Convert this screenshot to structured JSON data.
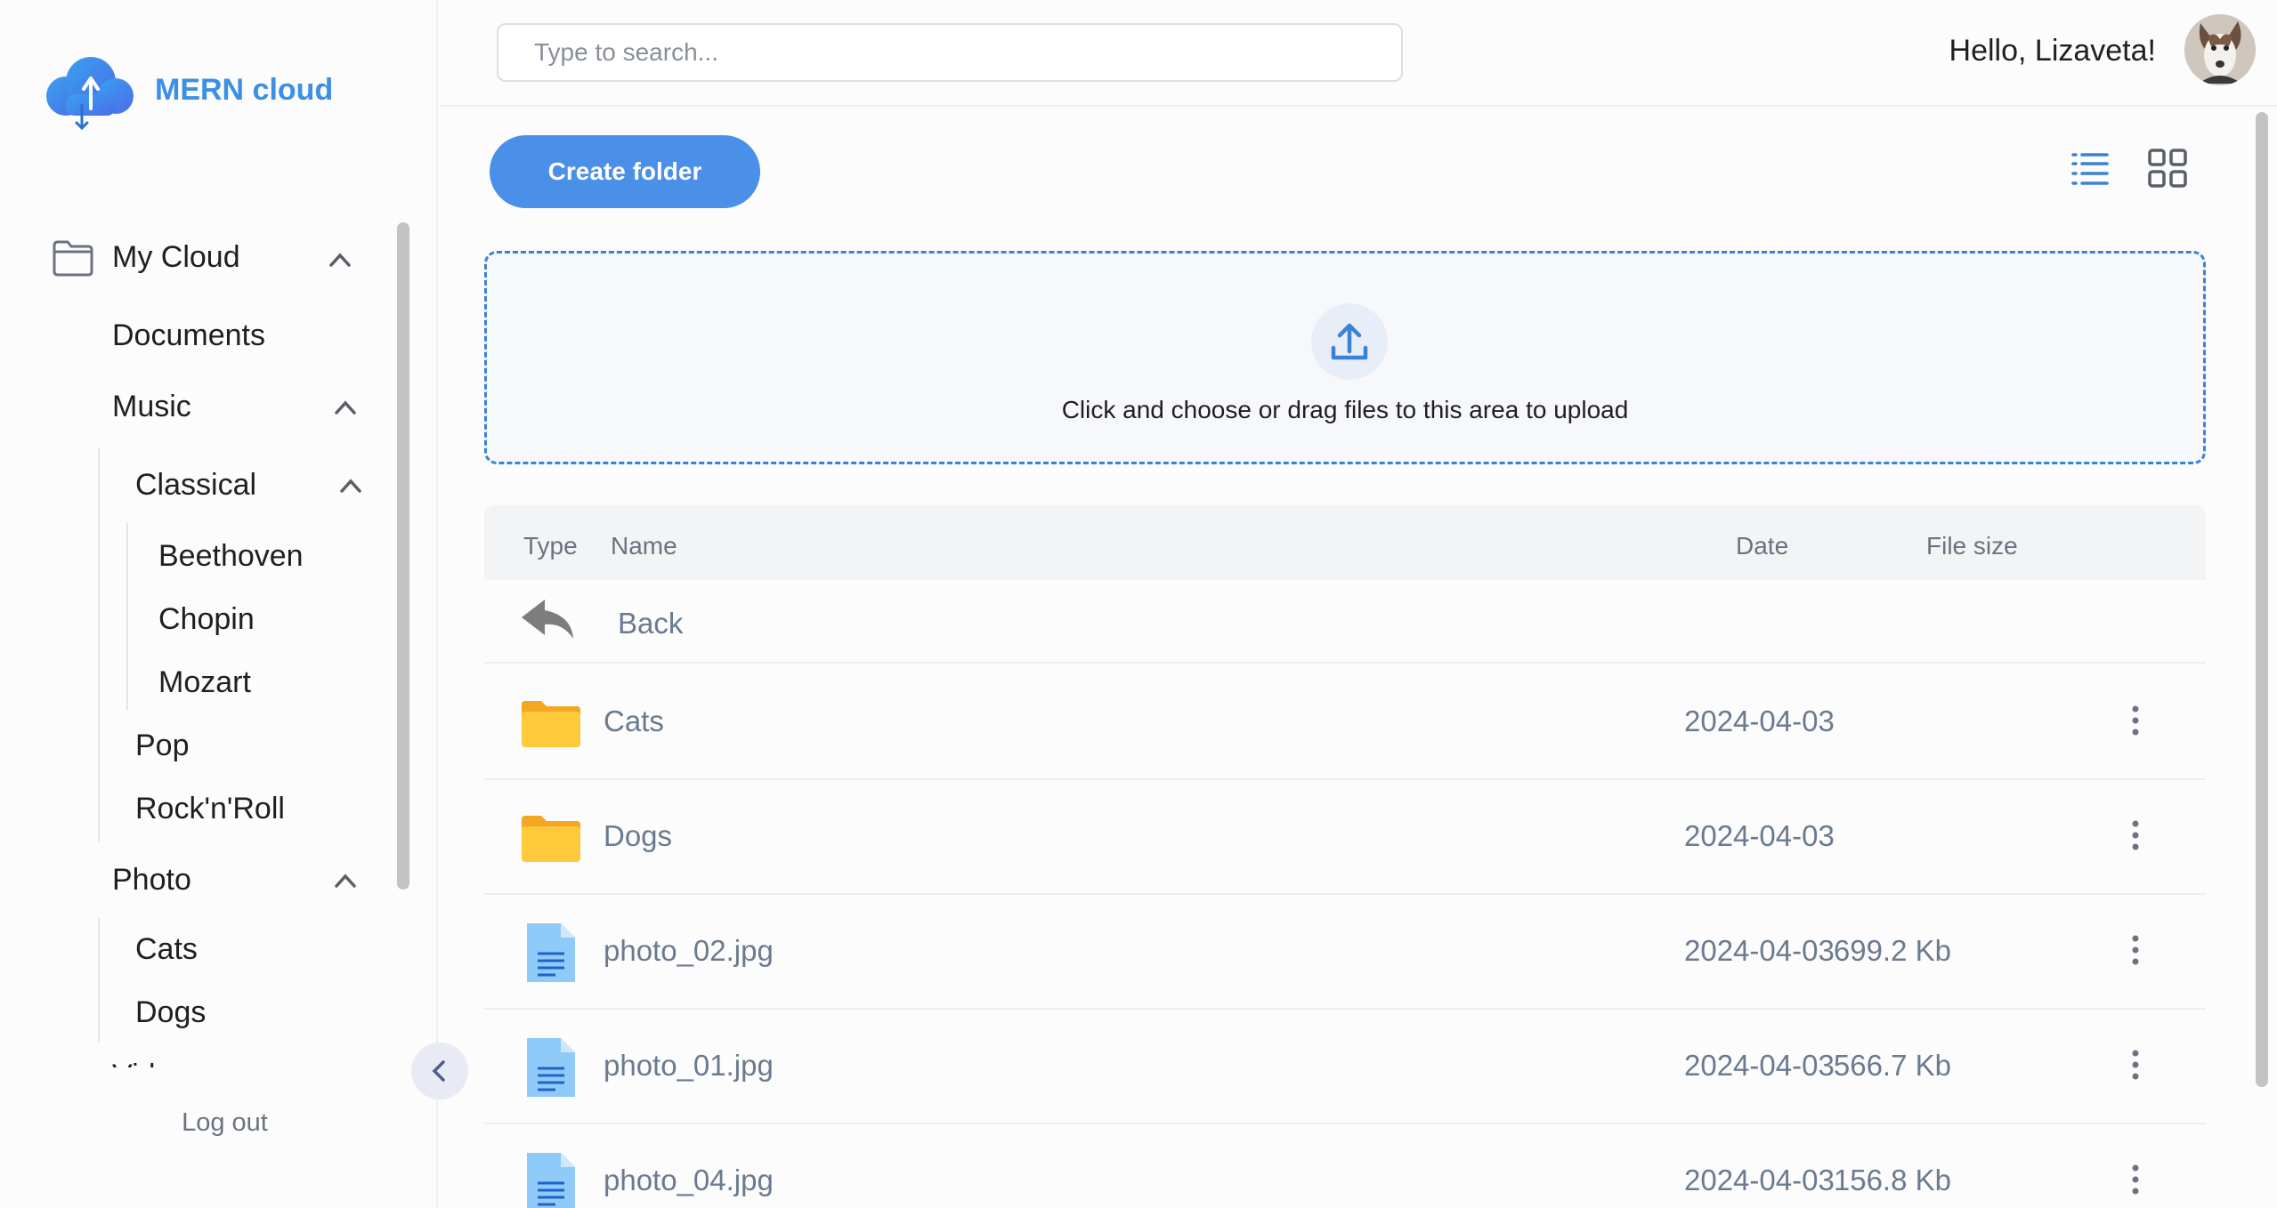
{
  "app": {
    "name": "MERN cloud",
    "accent": "#4a8fe8"
  },
  "sidebar": {
    "tree": [
      {
        "label": "My Cloud",
        "expanded": true
      },
      {
        "label": "Documents"
      },
      {
        "label": "Music",
        "expanded": true
      },
      {
        "label": "Classical",
        "expanded": true
      },
      {
        "label": "Beethoven"
      },
      {
        "label": "Chopin"
      },
      {
        "label": "Mozart"
      },
      {
        "label": "Pop"
      },
      {
        "label": "Rock'n'Roll"
      },
      {
        "label": "Photo",
        "expanded": true
      },
      {
        "label": "Cats"
      },
      {
        "label": "Dogs"
      },
      {
        "label": "Video"
      }
    ],
    "logout_label": "Log out"
  },
  "header": {
    "search_placeholder": "Type to search...",
    "greeting": "Hello, Lizaveta!"
  },
  "toolbar": {
    "create_folder_label": "Create folder",
    "view_mode": "list"
  },
  "upload": {
    "text": "Click and choose or drag files to this area to upload"
  },
  "table": {
    "columns": [
      "Type",
      "Name",
      "Date",
      "File size"
    ],
    "back_label": "Back",
    "rows": [
      {
        "type": "folder",
        "name": "Cats",
        "date": "2024-04-03",
        "size": ""
      },
      {
        "type": "folder",
        "name": "Dogs",
        "date": "2024-04-03",
        "size": ""
      },
      {
        "type": "file",
        "name": "photo_02.jpg",
        "date": "2024-04-03",
        "size": "699.2 Kb"
      },
      {
        "type": "file",
        "name": "photo_01.jpg",
        "date": "2024-04-03",
        "size": "566.7 Kb"
      },
      {
        "type": "file",
        "name": "photo_04.jpg",
        "date": "2024-04-03",
        "size": "156.8 Kb"
      }
    ]
  }
}
